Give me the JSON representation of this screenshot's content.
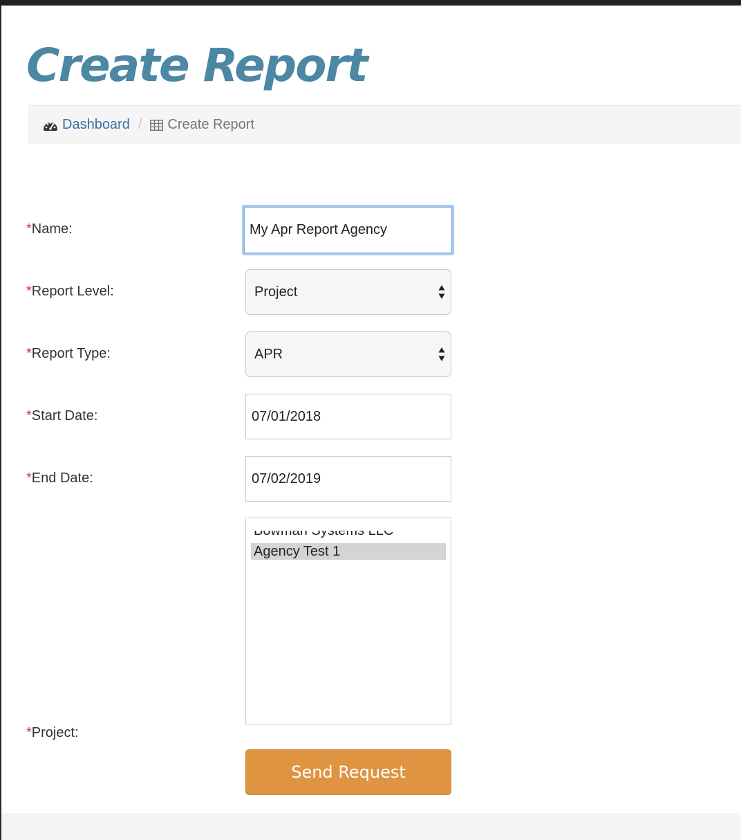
{
  "page": {
    "title": "Create Report"
  },
  "breadcrumb": {
    "home_label": "Dashboard",
    "home_icon": "dashboard-icon",
    "separator": "/",
    "current_label": "Create Report",
    "current_icon": "table-icon"
  },
  "form": {
    "required_marker": "*",
    "name": {
      "label": "Name:",
      "value": "My Apr Report Agency"
    },
    "report_level": {
      "label": "Report Level:",
      "value": "Project"
    },
    "report_type": {
      "label": "Report Type:",
      "value": "APR"
    },
    "start_date": {
      "label": "Start Date:",
      "value": "07/01/2018"
    },
    "end_date": {
      "label": "End Date:",
      "value": "07/02/2019"
    },
    "project": {
      "label": "Project:",
      "options": [
        "Bowman Systems LLC",
        "Agency Test 1"
      ],
      "selected": "Agency Test 1"
    },
    "submit_label": "Send Request"
  },
  "colors": {
    "title": "#4c87a4",
    "link": "#3a6fa6",
    "required": "#d9322e",
    "button": "#df9442",
    "focus_ring": "#a8c9f0"
  }
}
